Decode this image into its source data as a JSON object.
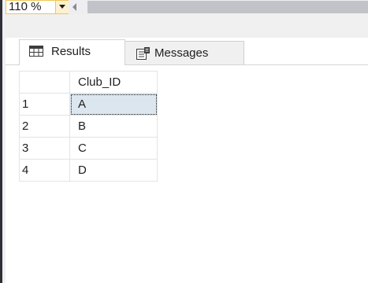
{
  "toolbar": {
    "zoom_value": "110 %"
  },
  "tabs": [
    {
      "label": "Results",
      "icon": "grid-icon",
      "active": true
    },
    {
      "label": "Messages",
      "icon": "messages-icon",
      "active": false
    }
  ],
  "grid": {
    "columns": [
      "Club_ID"
    ],
    "rows": [
      {
        "num": "1",
        "cells": [
          "A"
        ]
      },
      {
        "num": "2",
        "cells": [
          "B"
        ]
      },
      {
        "num": "3",
        "cells": [
          "C"
        ]
      },
      {
        "num": "4",
        "cells": [
          "D"
        ]
      }
    ],
    "selected_cell": {
      "row": 0,
      "col": 0
    }
  },
  "colors": {
    "zoom_border": "#f0c65a",
    "selection": "#dbe6ef",
    "scroll_track": "#c2c3c9"
  }
}
